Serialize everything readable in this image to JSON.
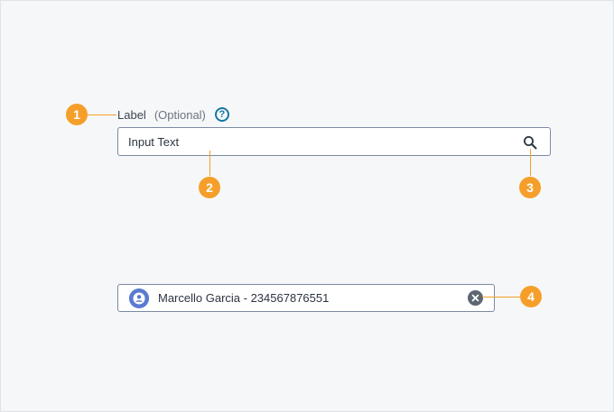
{
  "field": {
    "label": "Label",
    "optional": "(Optional)",
    "help_icon": "question-circle-icon",
    "value": "Input Text",
    "trailing_icon": "search-icon"
  },
  "chip_field": {
    "avatar_icon": "user-avatar-icon",
    "value": "Marcello Garcia - 234567876551",
    "clear_icon": "clear-circle-icon"
  },
  "callouts": [
    "1",
    "2",
    "3",
    "4"
  ],
  "colors": {
    "callout": "#f59f2a",
    "border": "#7b8aa3",
    "help": "#1478a3",
    "avatar": "#5b7bd1",
    "clear": "#5f6773"
  }
}
